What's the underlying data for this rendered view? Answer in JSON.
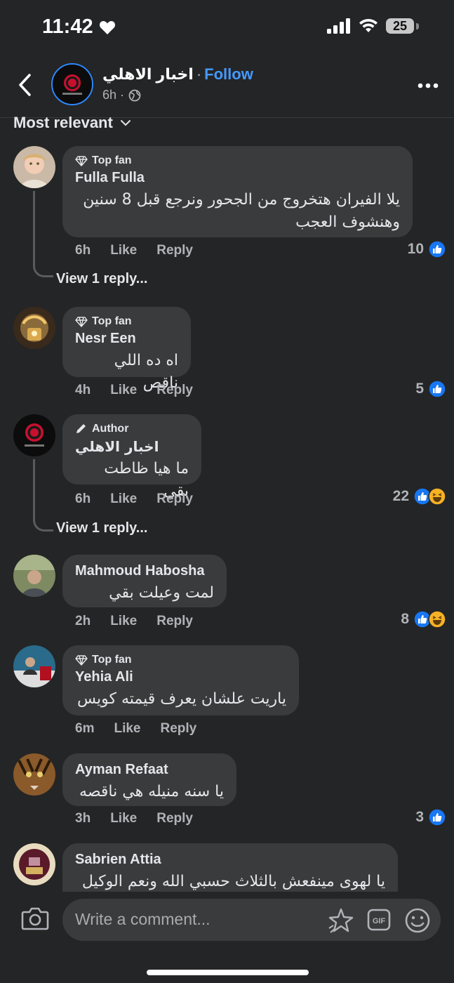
{
  "status_bar": {
    "time": "11:42",
    "battery": "25"
  },
  "header": {
    "page_name": "اخبار الاهلي",
    "separator": "·",
    "follow_label": "Follow",
    "time_ago": "6h ·"
  },
  "sort_label": "Most relevant",
  "comments": [
    {
      "badge": "Top fan",
      "author": "Fulla Fulla",
      "text": "يلا الفيران هتخروج من الجحور ونرجع قبل 8 سنين وهنشوف العجب",
      "time": "6h",
      "like": "Like",
      "reply": "Reply",
      "reactions": "10",
      "view_replies": "View 1 reply..."
    },
    {
      "badge": "Top fan",
      "author": "Nesr Een",
      "text": "اه ده اللي ناقص",
      "time": "4h",
      "like": "Like",
      "reply": "Reply",
      "reactions": "5"
    },
    {
      "badge": "Author",
      "author": "اخبار الاهلي",
      "text": "ما هيا ظاطت بقي",
      "time": "6h",
      "like": "Like",
      "reply": "Reply",
      "reactions": "22",
      "view_replies": "View 1 reply..."
    },
    {
      "author": "Mahmoud Habosha",
      "text": "لمت وعيلت بقي",
      "time": "2h",
      "like": "Like",
      "reply": "Reply",
      "reactions": "8"
    },
    {
      "badge": "Top fan",
      "author": "Yehia Ali",
      "text": "ياريت علشان يعرف قيمته كويس",
      "time": "6m",
      "like": "Like",
      "reply": "Reply"
    },
    {
      "author": "Ayman Refaat",
      "text": "يا سنه منيله هي ناقصه",
      "time": "3h",
      "like": "Like",
      "reply": "Reply",
      "reactions": "3"
    },
    {
      "author": "Sabrien Attia",
      "text": "يا لهوى مينفعش بالثلاث حسبي الله ونعم الوكيل"
    }
  ],
  "composer": {
    "placeholder": "Write a comment..."
  },
  "colors": {
    "background": "#242526",
    "bubble": "#3a3b3c",
    "accent": "#4599ff",
    "like_blue": "#1877f2"
  },
  "icons": [
    "back-chevron-icon",
    "globe-icon",
    "more-icon",
    "chevron-down-icon",
    "diamond-icon",
    "pen-icon",
    "like-icon",
    "haha-icon",
    "camera-icon",
    "sticker-icon",
    "gif-icon",
    "emoji-icon"
  ]
}
